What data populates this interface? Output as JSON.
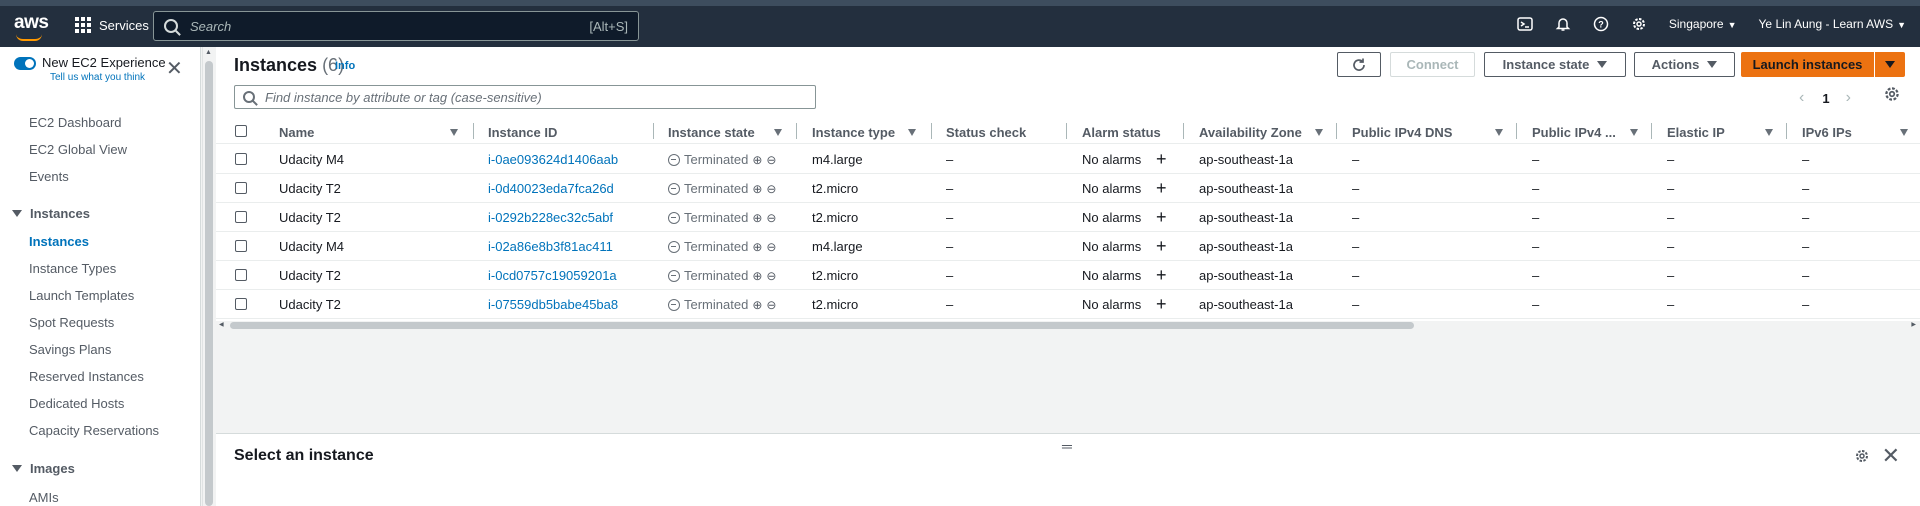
{
  "topnav": {
    "logo": "aws",
    "services": "Services",
    "search_placeholder": "Search",
    "search_hint": "[Alt+S]",
    "region": "Singapore",
    "account": "Ye Lin Aung - Learn AWS"
  },
  "sidebar": {
    "experience_label": "New EC2 Experience",
    "experience_sub": "Tell us what you think",
    "top_items": [
      "EC2 Dashboard",
      "EC2 Global View",
      "Events"
    ],
    "section_instances": "Instances",
    "instance_items": [
      "Instances",
      "Instance Types",
      "Launch Templates",
      "Spot Requests",
      "Savings Plans",
      "Reserved Instances",
      "Dedicated Hosts",
      "Capacity Reservations"
    ],
    "section_images": "Images",
    "image_items": [
      "AMIs"
    ]
  },
  "header": {
    "title": "Instances",
    "count": "(6)",
    "info": "Info",
    "connect": "Connect",
    "instance_state": "Instance state",
    "actions": "Actions",
    "launch": "Launch instances",
    "filter_placeholder": "Find instance by attribute or tag (case-sensitive)",
    "page": "1"
  },
  "table": {
    "columns": [
      "Name",
      "Instance ID",
      "Instance state",
      "Instance type",
      "Status check",
      "Alarm status",
      "Availability Zone",
      "Public IPv4 DNS",
      "Public IPv4 ...",
      "Elastic IP",
      "IPv6 IPs"
    ],
    "rows": [
      {
        "name": "Udacity M4",
        "id": "i-0ae093624d1406aab",
        "state": "Terminated",
        "type": "m4.large",
        "status": "–",
        "alarm": "No alarms",
        "az": "ap-southeast-1a",
        "dns": "–",
        "ipv4": "–",
        "eip": "–",
        "ipv6": "–"
      },
      {
        "name": "Udacity T2",
        "id": "i-0d40023eda7fca26d",
        "state": "Terminated",
        "type": "t2.micro",
        "status": "–",
        "alarm": "No alarms",
        "az": "ap-southeast-1a",
        "dns": "–",
        "ipv4": "–",
        "eip": "–",
        "ipv6": "–"
      },
      {
        "name": "Udacity T2",
        "id": "i-0292b228ec32c5abf",
        "state": "Terminated",
        "type": "t2.micro",
        "status": "–",
        "alarm": "No alarms",
        "az": "ap-southeast-1a",
        "dns": "–",
        "ipv4": "–",
        "eip": "–",
        "ipv6": "–"
      },
      {
        "name": "Udacity M4",
        "id": "i-02a86e8b3f81ac411",
        "state": "Terminated",
        "type": "m4.large",
        "status": "–",
        "alarm": "No alarms",
        "az": "ap-southeast-1a",
        "dns": "–",
        "ipv4": "–",
        "eip": "–",
        "ipv6": "–"
      },
      {
        "name": "Udacity T2",
        "id": "i-0cd0757c19059201a",
        "state": "Terminated",
        "type": "t2.micro",
        "status": "–",
        "alarm": "No alarms",
        "az": "ap-southeast-1a",
        "dns": "–",
        "ipv4": "–",
        "eip": "–",
        "ipv6": "–"
      },
      {
        "name": "Udacity T2",
        "id": "i-07559db5babe45ba8",
        "state": "Terminated",
        "type": "t2.micro",
        "status": "–",
        "alarm": "No alarms",
        "az": "ap-southeast-1a",
        "dns": "–",
        "ipv4": "–",
        "eip": "–",
        "ipv6": "–"
      }
    ]
  },
  "split": {
    "title": "Select an instance"
  },
  "colors": {
    "nav_bg": "#232f3e",
    "link": "#0073bb",
    "primary": "#ec7211"
  }
}
